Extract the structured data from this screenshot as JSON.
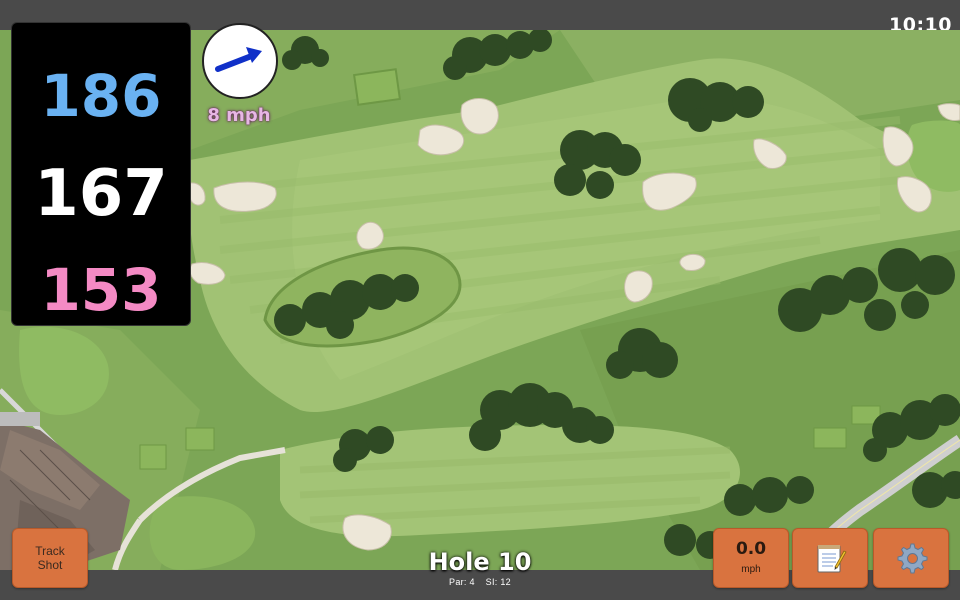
{
  "status_bar": {
    "time": "10:10"
  },
  "distances": {
    "back": "186",
    "middle": "167",
    "front": "153"
  },
  "wind": {
    "speed_label": "8 mph",
    "direction_icon": "arrow-icon"
  },
  "hole": {
    "title": "Hole 10",
    "par_label": "Par: 4",
    "stroke_index_label": "SI: 12"
  },
  "buttons": {
    "track_shot_line1": "Track",
    "track_shot_line2": "Shot",
    "speed_value": "0.0",
    "speed_unit": "mph",
    "notes_icon": "notepad-icon",
    "settings_icon": "gear-icon"
  },
  "colors": {
    "back_distance": "#6ab2f2",
    "middle_distance": "#ffffff",
    "front_distance": "#f48ac4",
    "button_orange": "#d9733f",
    "wind_arrow": "#1030c8"
  }
}
